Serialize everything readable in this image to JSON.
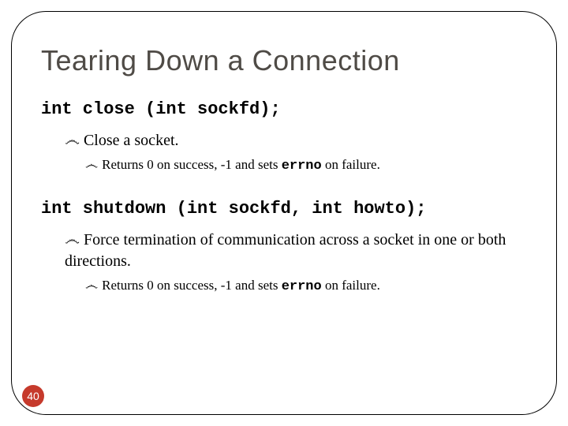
{
  "title": "Tearing Down a Connection",
  "sections": [
    {
      "code": "int close (int sockfd);",
      "bullet": "Close a socket.",
      "sub_pre": "Returns 0 on success, -1 and sets ",
      "sub_code": "errno",
      "sub_post": " on failure."
    },
    {
      "code": "int shutdown (int sockfd, int howto);",
      "bullet": "Force termination of communication across a socket in one or both directions.",
      "sub_pre": "Returns 0 on success, -1 and sets ",
      "sub_code": "errno",
      "sub_post": " on failure."
    }
  ],
  "bullet_glyph": "෴",
  "page_number": "40"
}
